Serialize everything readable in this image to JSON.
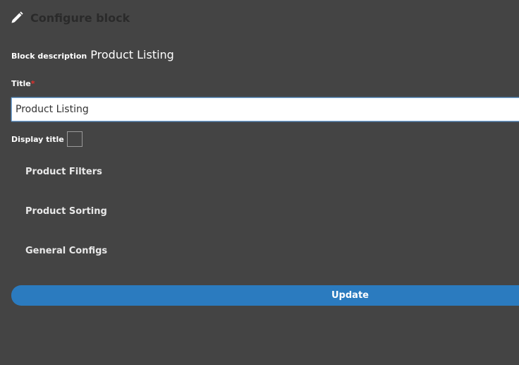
{
  "header": {
    "title": "Configure block",
    "icon": "pencil-icon"
  },
  "block_description": {
    "label": "Block description",
    "value": "Product Listing"
  },
  "title_field": {
    "label": "Title",
    "required_marker": "*",
    "value": "Product Listing"
  },
  "display_title": {
    "label": "Display title",
    "checked": false
  },
  "sections": [
    {
      "label": "Product Filters"
    },
    {
      "label": "Product Sorting"
    },
    {
      "label": "General Configs"
    }
  ],
  "actions": {
    "update_label": "Update"
  },
  "colors": {
    "background": "#444444",
    "accent": "#2b7bbf",
    "required": "#e0302c"
  }
}
